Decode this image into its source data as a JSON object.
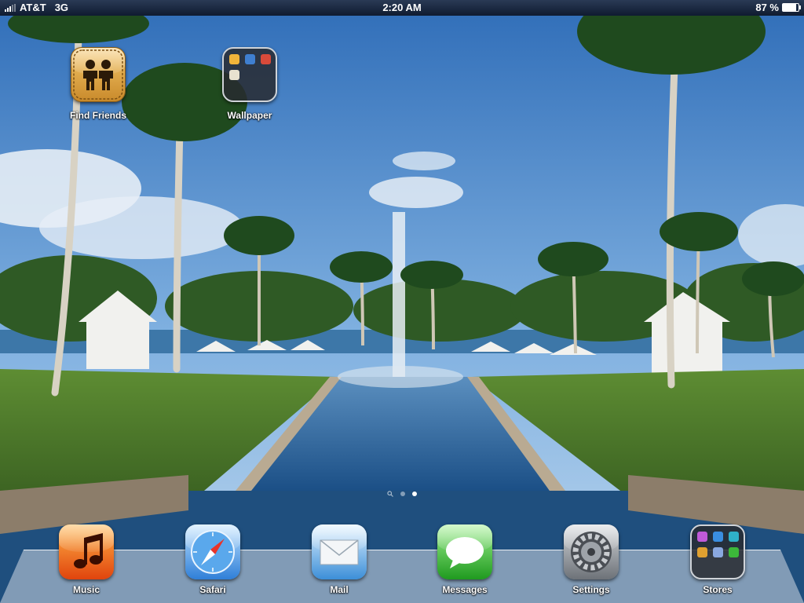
{
  "status": {
    "carrier": "AT&T",
    "network": "3G",
    "time": "2:20 AM",
    "battery": "87 %",
    "battery_level": 0.87
  },
  "home_apps": [
    {
      "label": "Find Friends",
      "icon": "find-friends-icon"
    },
    {
      "label": "Wallpaper",
      "icon": "folder-icon"
    }
  ],
  "dock_apps": [
    {
      "label": "Music",
      "icon": "music-note-icon"
    },
    {
      "label": "Safari",
      "icon": "compass-icon"
    },
    {
      "label": "Mail",
      "icon": "envelope-icon"
    },
    {
      "label": "Messages",
      "icon": "speech-bubble-icon"
    },
    {
      "label": "Settings",
      "icon": "gears-icon"
    },
    {
      "label": "Stores",
      "icon": "folder-icon"
    }
  ],
  "page_indicator": {
    "pages": 2,
    "current": 2,
    "has_search_page": true
  },
  "colors": {
    "sky": "#5b96d2",
    "grass": "#4d7a2c",
    "water": "#2f6aa0",
    "find_friends": "#e3a640",
    "music": "#f06a10",
    "safari": "#3a8ee0",
    "mail": "#4aa6e6",
    "messages": "#3cb83a",
    "settings": "#8a8f96"
  }
}
